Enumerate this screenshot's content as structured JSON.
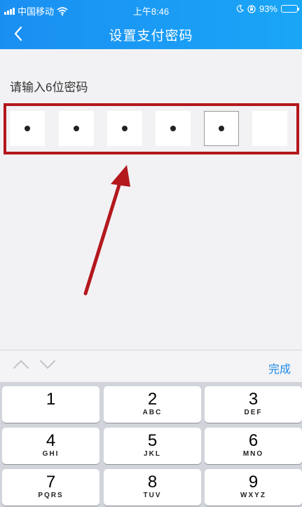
{
  "status_bar": {
    "carrier": "中国移动",
    "time": "上午8:46",
    "battery_percent": "93%",
    "battery_level": 0.93
  },
  "nav": {
    "title": "设置支付密码",
    "back_icon": "chevron-left-icon"
  },
  "pin": {
    "prompt": "请输入6位密码",
    "length": 6,
    "filled_count": 5,
    "active_index": 4
  },
  "annotation": {
    "box_color": "#b3181d",
    "arrow_color": "#b3181d"
  },
  "keyboard": {
    "toolbar_done": "完成",
    "prev_icon": "chevron-up-icon",
    "next_icon": "chevron-down-icon",
    "keys": [
      {
        "num": "1",
        "letters": ""
      },
      {
        "num": "2",
        "letters": "ABC"
      },
      {
        "num": "3",
        "letters": "DEF"
      },
      {
        "num": "4",
        "letters": "GHI"
      },
      {
        "num": "5",
        "letters": "JKL"
      },
      {
        "num": "6",
        "letters": "MNO"
      },
      {
        "num": "7",
        "letters": "PQRS"
      },
      {
        "num": "8",
        "letters": "TUV"
      },
      {
        "num": "9",
        "letters": "WXYZ"
      }
    ]
  },
  "colors": {
    "header_start": "#1a8ff2",
    "header_end": "#1aa6f7",
    "accent": "#1e88e5"
  }
}
